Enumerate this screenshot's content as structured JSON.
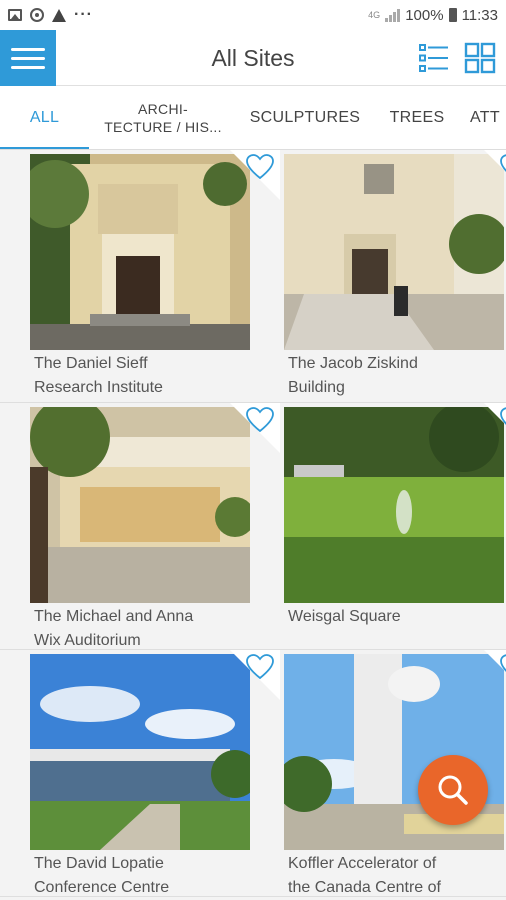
{
  "status_bar": {
    "battery_text": "100%",
    "time": "11:33",
    "network_label": "4G",
    "icons": [
      "image-icon",
      "data-saver-icon",
      "warning-icon",
      "more-dots-icon",
      "signal-icon",
      "battery-icon"
    ]
  },
  "app_bar": {
    "title": "All Sites",
    "accent_color": "#2f9ad8",
    "menu_icon": "hamburger-menu-icon",
    "list_view_icon": "list-view-icon",
    "grid_view_icon": "grid-view-icon"
  },
  "tabs": [
    {
      "label": "ALL",
      "active": true
    },
    {
      "label": "ARCHI-\nTECTURE / HIS...",
      "active": false
    },
    {
      "label": "SCULPTURES",
      "active": false
    },
    {
      "label": "TREES",
      "active": false
    },
    {
      "label": "ATT",
      "active": false
    }
  ],
  "sites": [
    {
      "caption": "The Daniel Sieff\nResearch Institute",
      "favorite_icon": "heart-outline-icon"
    },
    {
      "caption": "The Jacob Ziskind\nBuilding",
      "favorite_icon": "heart-outline-icon"
    },
    {
      "caption": "The Michael and Anna\nWix Auditorium",
      "favorite_icon": "heart-outline-icon"
    },
    {
      "caption": "Weisgal Square",
      "favorite_icon": "heart-outline-icon"
    },
    {
      "caption": "The David Lopatie\nConference Centre",
      "favorite_icon": "heart-outline-icon"
    },
    {
      "caption": "Koffler Accelerator of\nthe Canada Centre of",
      "favorite_icon": "heart-outline-icon"
    }
  ],
  "fab": {
    "icon": "search-icon",
    "color": "#e9662a"
  }
}
